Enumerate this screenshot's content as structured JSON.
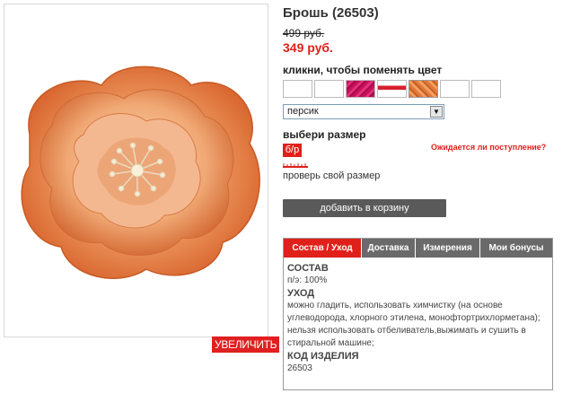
{
  "product": {
    "title": "Брошь (26503)",
    "old_price": "499 руб.",
    "new_price": "349 руб.",
    "zoom_label": "УВЕЛИЧИТЬ"
  },
  "colors": {
    "label": "кликни, чтобы поменять цвет",
    "swatches": [
      "white",
      "white",
      "magenta",
      "red-white",
      "orange",
      "white",
      "white"
    ],
    "selected": "персик",
    "accent": "#e0201a"
  },
  "size": {
    "label": "выбери размер",
    "option": "б/р",
    "expected_link": "Ожидается ли поступление?",
    "check_size": "проверь свой размер"
  },
  "cart": {
    "button_label": "добавить в корзину"
  },
  "tabs": [
    {
      "label": "Состав / Уход",
      "active": true
    },
    {
      "label": "Доставка",
      "active": false
    },
    {
      "label": "Измерения",
      "active": false
    },
    {
      "label": "Мои бонусы",
      "active": false
    }
  ],
  "details": {
    "composition_heading": "СОСТАВ",
    "composition": "п/э: 100%",
    "care_heading": "УХОД",
    "care": "можно гладить, использовать химчистку (на основе углеводорода, хлорного этилена, монофтортрихлорметана); нельзя использовать отбеливатель,выжимать и сушить в стиральной машине;",
    "code_heading": "КОД ИЗДЕЛИЯ",
    "code": "26503"
  }
}
